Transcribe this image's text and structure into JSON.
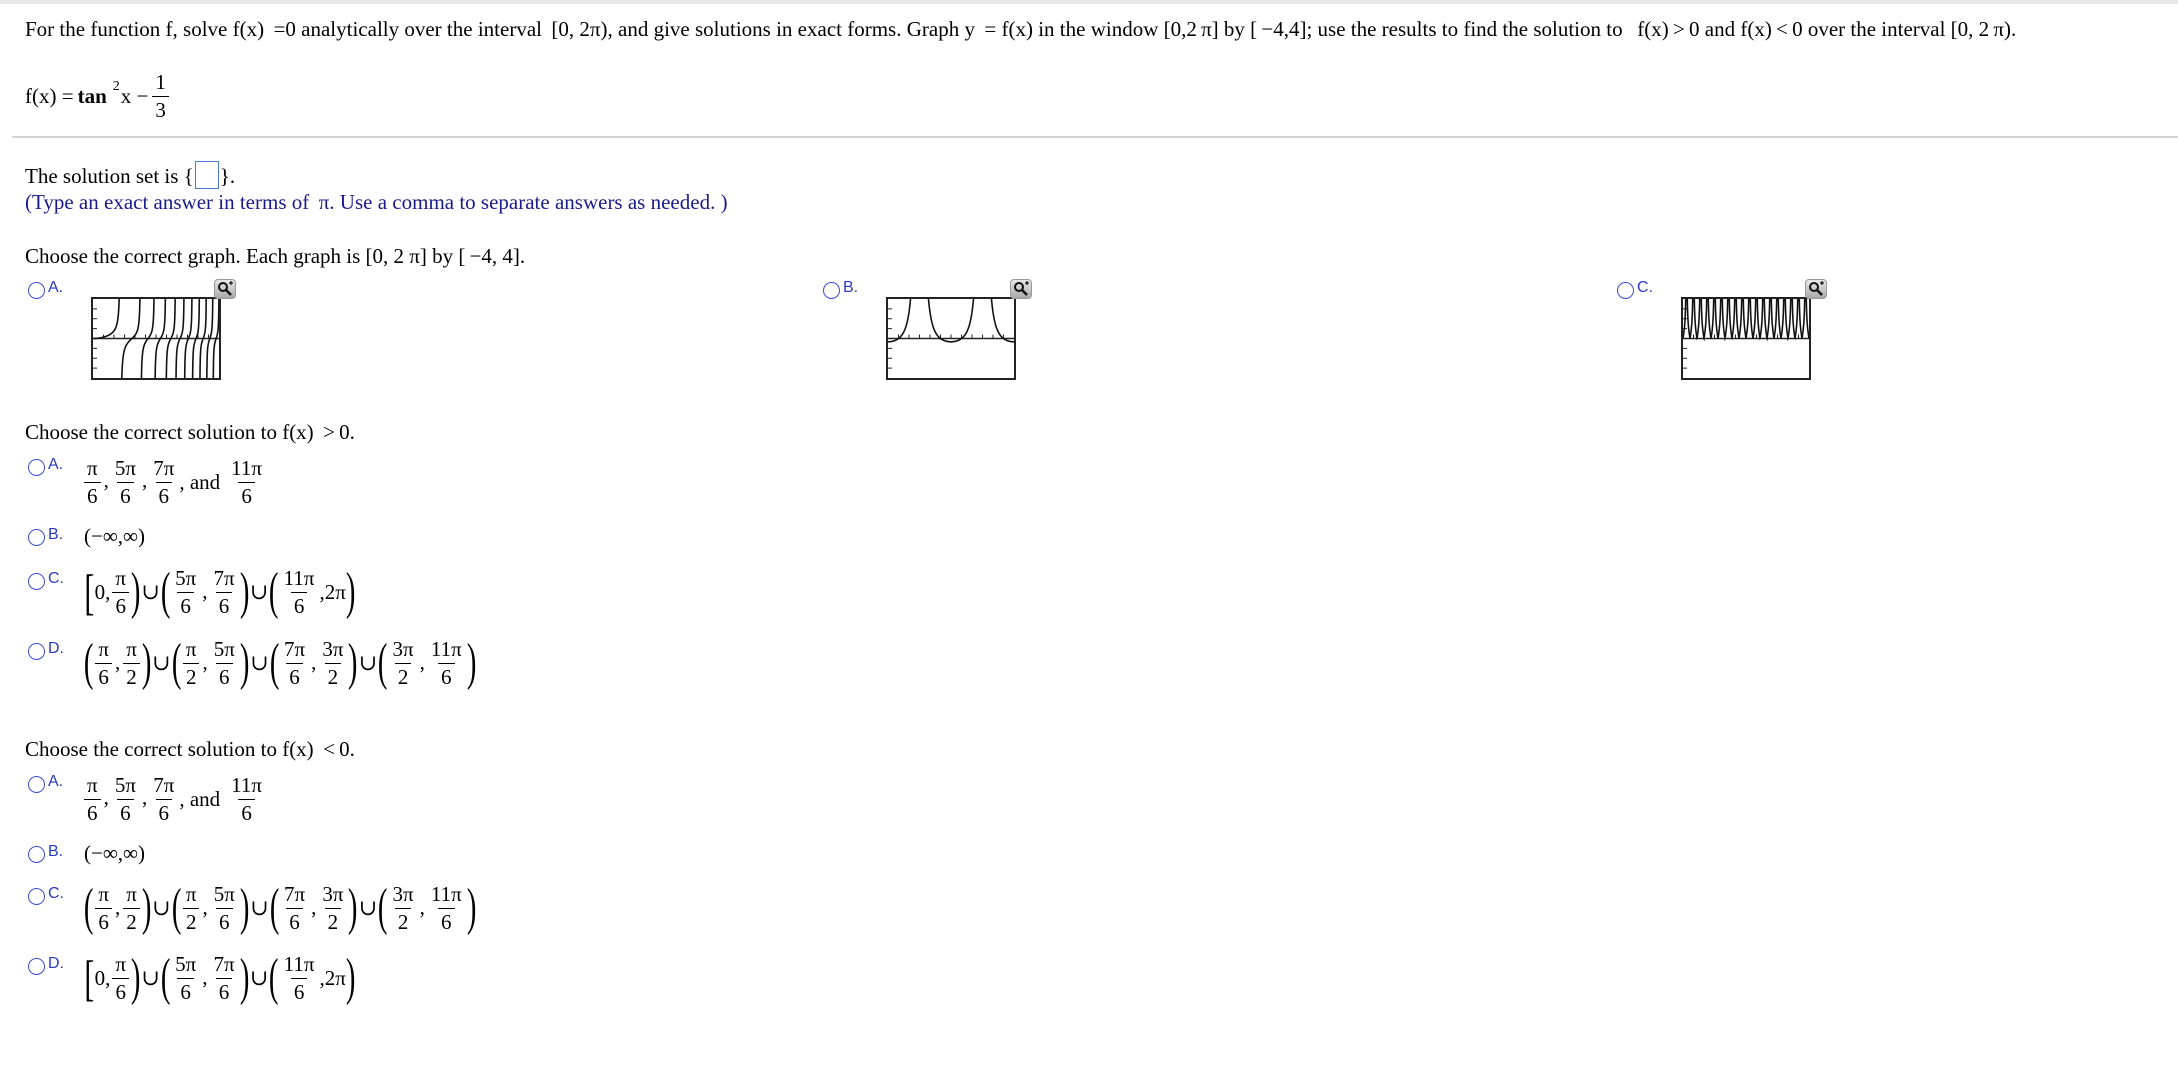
{
  "question": {
    "prompt": "For the function f, solve f(x)  =0 analytically over the interval  [0, 2π), and give solutions in exact forms. Graph y  = f(x) in the window [0,2 π] by [ −4,4]; use the results to find the solution to   f(x) > 0 and f(x) < 0 over the interval [0, 2 π).",
    "function_lhs": "f(x) = ",
    "function_tan": "tan",
    "function_exp": "2",
    "function_var": "x −",
    "function_frac_num": "1",
    "function_frac_den": "3"
  },
  "solution_set": {
    "label_before": "The solution set is {",
    "label_after": "}.",
    "input_value": "",
    "hint": "(Type an exact answer in terms of  π. Use a comma to separate answers as needed. )"
  },
  "graph_question": {
    "prompt": "Choose the correct graph. Each graph is [0, 2 π] by [ −4, 4].",
    "options": [
      {
        "letter": "A.",
        "description": "tan-like curves with increasing frequency",
        "zoom_icon": "magnifier-plus-icon"
      },
      {
        "letter": "B.",
        "description": "tan^2 x - 1/3 U-shaped curves above axis",
        "zoom_icon": "magnifier-plus-icon"
      },
      {
        "letter": "C.",
        "description": "dense oscillation above axis",
        "zoom_icon": "magnifier-plus-icon"
      }
    ]
  },
  "positive_question": {
    "prompt": "Choose the correct solution to f(x)  > 0.",
    "options": [
      {
        "letter": "A.",
        "text": "π/6, 5π/6, 7π/6, and 11π/6"
      },
      {
        "letter": "B.",
        "text": "(−∞,∞)"
      },
      {
        "letter": "C.",
        "text": "[0,π/6)∪(5π/6,7π/6)∪(11π/6,2π)"
      },
      {
        "letter": "D.",
        "text": "(π/6,π/2)∪(π/2,5π/6)∪(7π/6,3π/2)∪(3π/2,11π/6)"
      }
    ]
  },
  "negative_question": {
    "prompt": "Choose the correct solution to f(x)  < 0.",
    "options": [
      {
        "letter": "A.",
        "text": "π/6, 5π/6, 7π/6, and 11π/6"
      },
      {
        "letter": "B.",
        "text": "(−∞,∞)"
      },
      {
        "letter": "C.",
        "text": "(π/6,π/2)∪(π/2,5π/6)∪(7π/6,3π/2)∪(3π/2,11π/6)"
      },
      {
        "letter": "D.",
        "text": "[0,π/6)∪(5π/6,7π/6)∪(11π/6,2π)"
      }
    ]
  },
  "math": {
    "pi": "π",
    "five_pi": "5π",
    "seven_pi": "7π",
    "eleven_pi": "11π",
    "three_pi": "3π",
    "six": "6",
    "two": "2",
    "comma": ",",
    "and": ", and",
    "zero_comma": "0,",
    "two_pi_tail": ",2π",
    "cup": "∪",
    "lparen": "(",
    "rparen": ")",
    "lbracket": "[",
    "real_line": "(−∞,∞)"
  },
  "colors": {
    "hint_text": "#1a1a8c",
    "radio_border": "#3a4fd0",
    "input_border": "#4a78d6",
    "divider": "#d4d4d4"
  }
}
